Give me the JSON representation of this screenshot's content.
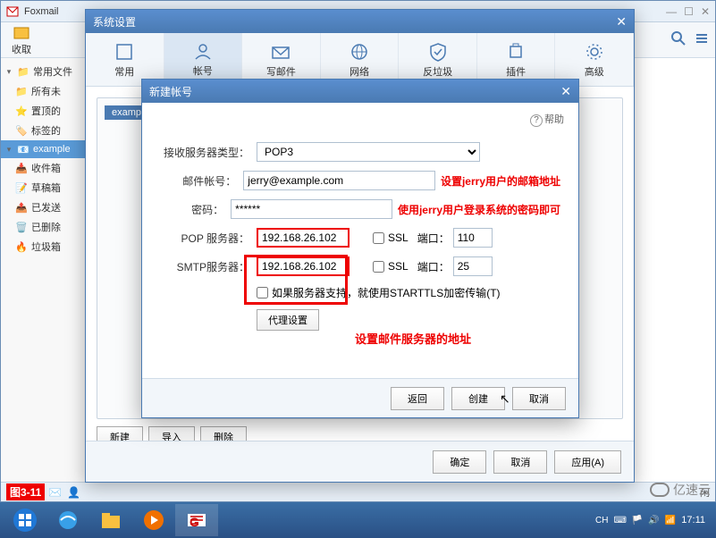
{
  "foxmail": {
    "title": "Foxmail",
    "toolbar_receive": "收取",
    "toolbar_right_icons": [
      "search-icon",
      "menu-icon"
    ],
    "sidebar": {
      "common_files": "常用文件",
      "all": "所有未",
      "pinned": "置顶的",
      "tags": "标签的",
      "account": "example",
      "inbox": "收件箱",
      "drafts": "草稿箱",
      "sent": "已发送",
      "trash": "已删除",
      "junk": "垃圾箱"
    },
    "status_label": "图3-11",
    "idle_text": "闲"
  },
  "settings": {
    "title": "系统设置",
    "tabs": {
      "common": "常用",
      "account": "帐号",
      "compose": "写邮件",
      "network": "网络",
      "antispam": "反垃圾",
      "plugin": "插件",
      "advanced": "高级"
    },
    "card_tag": "exampl",
    "btn_new": "新建",
    "btn_import": "导入",
    "btn_delete": "删除",
    "btn_ok": "确定",
    "btn_cancel": "取消",
    "btn_apply": "应用(A)"
  },
  "newacct": {
    "title": "新建帐号",
    "help": "帮助",
    "labels": {
      "server_type": "接收服务器类型：",
      "email": "邮件帐号：",
      "password": "密码：",
      "pop": "POP 服务器：",
      "smtp": "SMTP服务器：",
      "ssl": "SSL",
      "port": "端口：",
      "starttls": "如果服务器支持，就使用STARTTLS加密传输(T)",
      "proxy": "代理设置"
    },
    "values": {
      "server_type": "POP3",
      "email": "jerry@example.com",
      "password": "******",
      "pop_server": "192.168.26.102",
      "smtp_server": "192.168.26.102",
      "pop_port": "110",
      "smtp_port": "25"
    },
    "annotations": {
      "email": "设置jerry用户的邮箱地址",
      "password": "使用jerry用户登录系统的密码即可",
      "server": "设置邮件服务器的地址"
    },
    "btn_back": "返回",
    "btn_create": "创建",
    "btn_cancel": "取消"
  },
  "taskbar": {
    "ime": "CH",
    "time": "17:11"
  },
  "watermark": "亿速云"
}
